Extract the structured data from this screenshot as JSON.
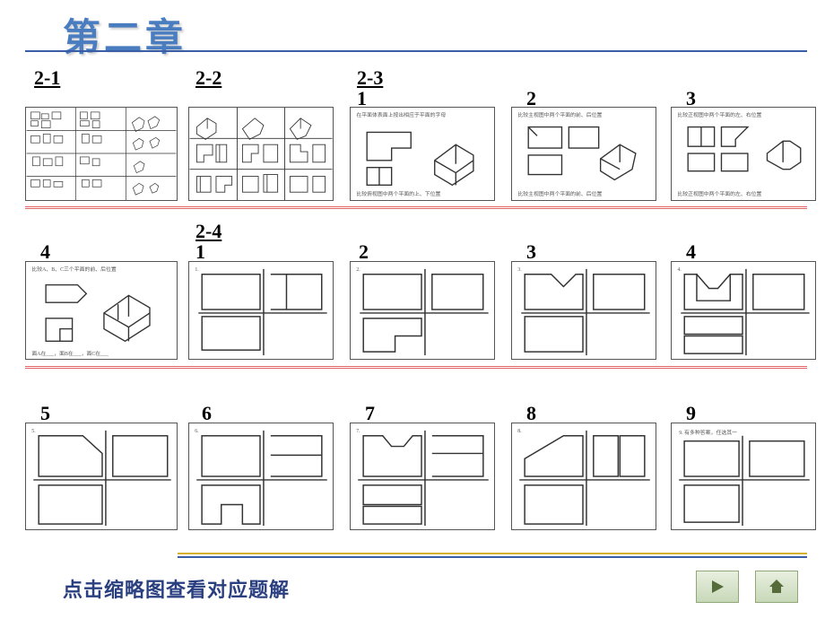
{
  "title": "第二章",
  "sections": {
    "s21": "2-1",
    "s22": "2-2",
    "s23": "2-3",
    "s24": "2-4"
  },
  "row1_items": [
    "1",
    "2",
    "3"
  ],
  "row2_items": [
    "4",
    "1",
    "2",
    "3",
    "4"
  ],
  "row3_items": [
    "5",
    "6",
    "7",
    "8",
    "9"
  ],
  "footer": "点击缩略图查看对应题解",
  "tinytext": {
    "r1c3": "在平面体表面上按出相应于平面的字母",
    "r1c4": "比较主视图中两个平面的前、后位置",
    "r1c5": "比较正视图中两个平面的左、右位置",
    "r2c1": "比较A、B、C三个平面的前、后位置",
    "r3c5": "9. 有多种答案，任选其一"
  }
}
